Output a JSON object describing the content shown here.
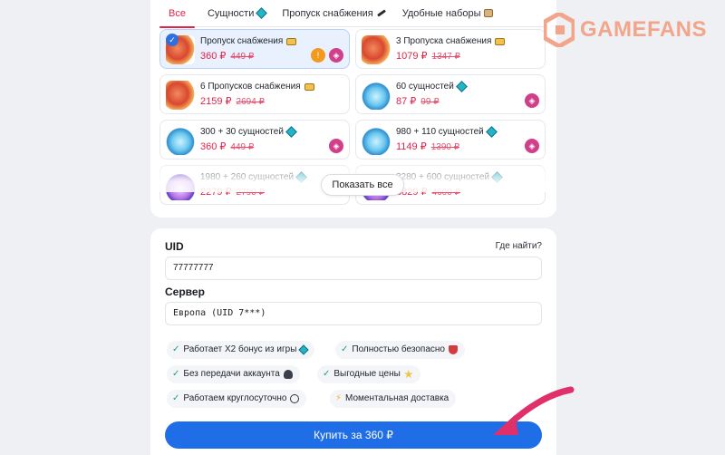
{
  "tabs": [
    {
      "label": "Все",
      "icon": ""
    },
    {
      "label": "Сущности",
      "icon": "gem-icon"
    },
    {
      "label": "Пропуск снабжения",
      "icon": "pencil-icon"
    },
    {
      "label": "Удобные наборы",
      "icon": "box-icon"
    }
  ],
  "items": [
    {
      "name": "Пропуск снабжения",
      "price": "360 ₽",
      "old_price": "449 ₽",
      "icon": "pass-icon",
      "selected": true
    },
    {
      "name": "3 Пропуска снабжения",
      "price": "1079 ₽",
      "old_price": "1347 ₽",
      "icon": "pass-icon"
    },
    {
      "name": "6 Пропусков снабжения",
      "price": "2159 ₽",
      "old_price": "2694 ₽",
      "icon": "pass-icon"
    },
    {
      "name": "60 сущностей",
      "price": "87 ₽",
      "old_price": "99 ₽",
      "icon": "gem-icon"
    },
    {
      "name": "300 + 30 сущностей",
      "price": "360 ₽",
      "old_price": "449 ₽",
      "icon": "gem-icon"
    },
    {
      "name": "980 + 110 сущностей",
      "price": "1149 ₽",
      "old_price": "1390 ₽",
      "icon": "gem-icon"
    },
    {
      "name": "1980 + 260 сущностей",
      "price": "2279 ₽",
      "old_price": "2790 ₽",
      "icon": "gem-icon"
    },
    {
      "name": "3280 + 600 сущностей",
      "price": "3829 ₽",
      "old_price": "4600 ₽",
      "icon": "gem-icon"
    }
  ],
  "show_all_label": "Показать все",
  "form": {
    "uid_label": "UID",
    "where_link": "Где найти?",
    "uid_value": "77777777",
    "server_label": "Сервер",
    "server_value": "Европа (UID 7***)"
  },
  "features": [
    "Работает X2 бонус из игры",
    "Полностью безопасно",
    "Без передачи аккаунта",
    "Выгодные цены",
    "Работаем круглосуточно",
    "Моментальная доставка"
  ],
  "buy_label": "Купить за 360 ₽",
  "watermark": "GAMEFANS",
  "colors": {
    "accent": "#e0254a",
    "primary": "#1f6ee8",
    "arrow": "#e0306a"
  }
}
